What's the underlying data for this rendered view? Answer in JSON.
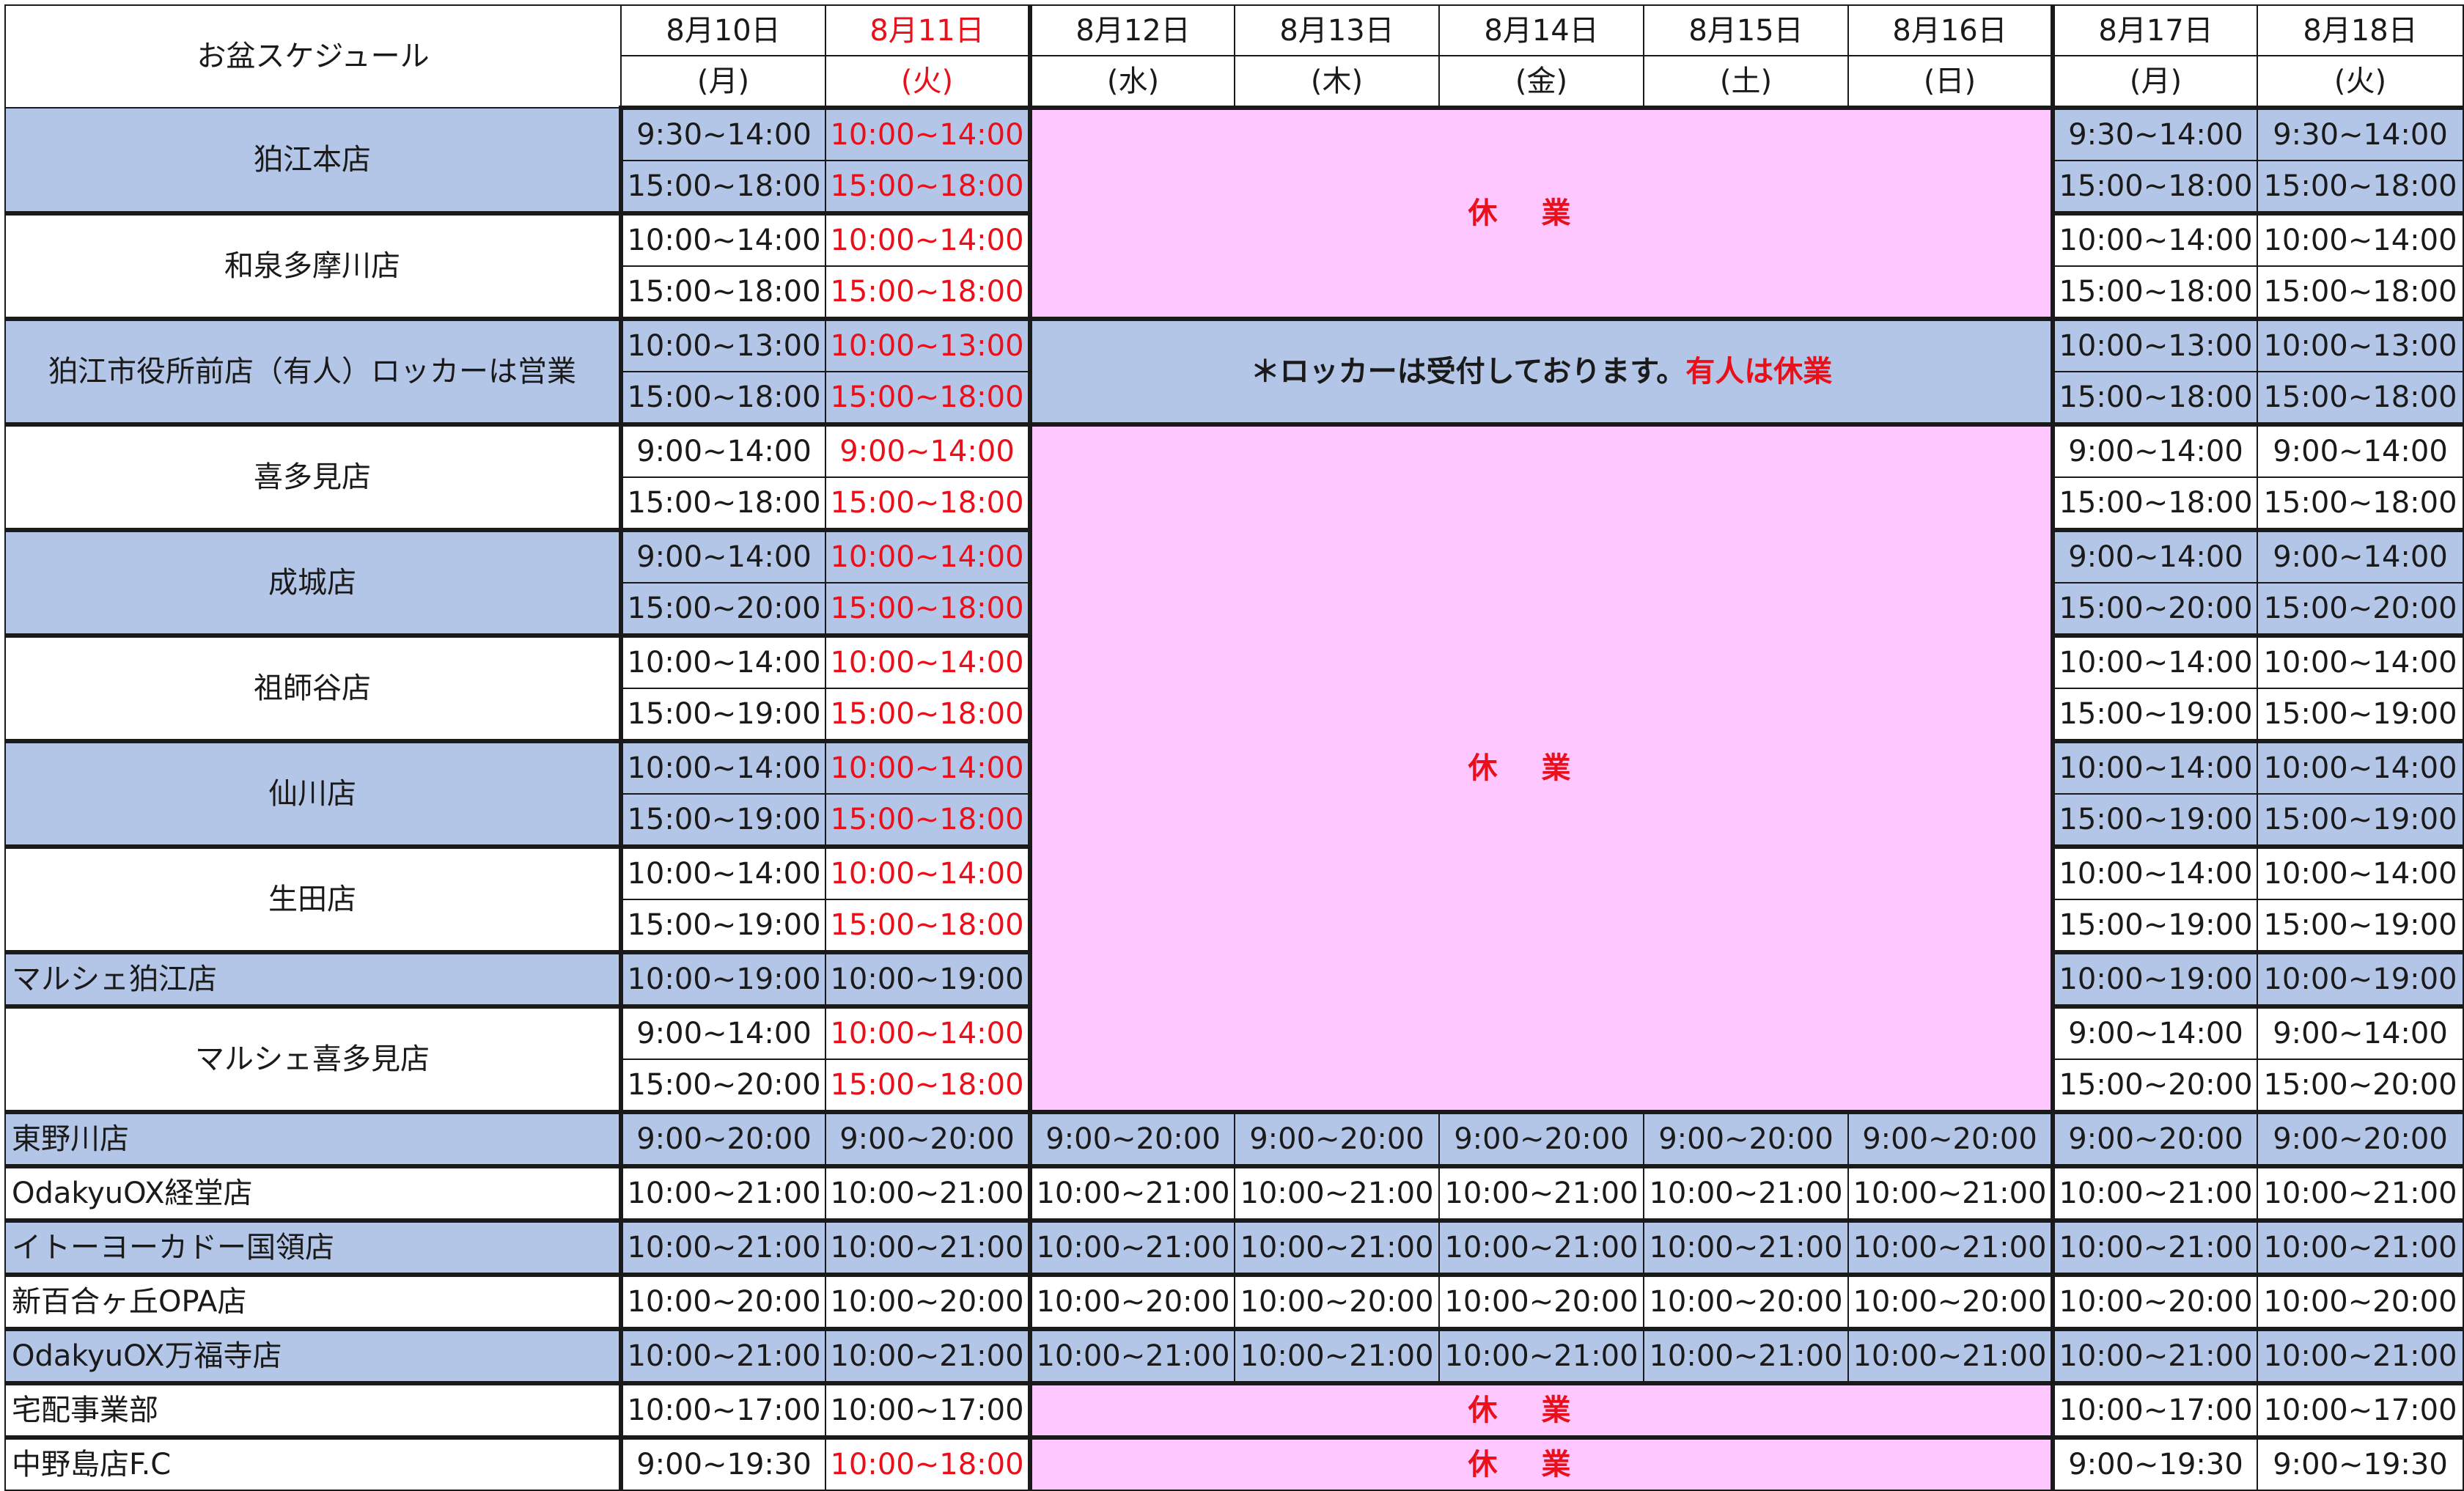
{
  "title": "お盆スケジュール",
  "dates": [
    {
      "date": "8月10日",
      "dow": "(月)",
      "red": false
    },
    {
      "date": "8月11日",
      "dow": "(火)",
      "red": true
    },
    {
      "date": "8月12日",
      "dow": "(水)",
      "red": false
    },
    {
      "date": "8月13日",
      "dow": "(木)",
      "red": false
    },
    {
      "date": "8月14日",
      "dow": "(金)",
      "red": false
    },
    {
      "date": "8月15日",
      "dow": "(土)",
      "red": false
    },
    {
      "date": "8月16日",
      "dow": "(日)",
      "red": false
    },
    {
      "date": "8月17日",
      "dow": "(月)",
      "red": false
    },
    {
      "date": "8月18日",
      "dow": "(火)",
      "red": false
    }
  ],
  "closed_label": "休業",
  "locker_note": {
    "black": "＊ロッカーは受付しております。",
    "red": "有人は休業"
  },
  "colors": {
    "blue": "#b4c6e7",
    "pink": "#ffc7ff",
    "red": "#e8101a"
  },
  "stores": [
    {
      "name": "狛江本店",
      "bg": "blue",
      "align": "center",
      "rows": [
        [
          "9:30~14:00",
          "10:00~14:00",
          "9:30~14:00",
          "9:30~14:00"
        ],
        [
          "15:00~18:00",
          "15:00~18:00",
          "15:00~18:00",
          "15:00~18:00"
        ]
      ],
      "red11": true,
      "mid": "closed-block"
    },
    {
      "name": "和泉多摩川店",
      "bg": "white",
      "align": "center",
      "rows": [
        [
          "10:00~14:00",
          "10:00~14:00",
          "10:00~14:00",
          "10:00~14:00"
        ],
        [
          "15:00~18:00",
          "15:00~18:00",
          "15:00~18:00",
          "15:00~18:00"
        ]
      ],
      "red11": true,
      "mid": "covered"
    },
    {
      "name": "狛江市役所前店（有人）ロッカーは営業",
      "bg": "blue",
      "align": "center",
      "rows": [
        [
          "10:00~13:00",
          "10:00~13:00",
          "10:00~13:00",
          "10:00~13:00"
        ],
        [
          "15:00~18:00",
          "15:00~18:00",
          "15:00~18:00",
          "15:00~18:00"
        ]
      ],
      "red11": true,
      "mid": "locker"
    },
    {
      "name": "喜多見店",
      "bg": "white",
      "align": "center",
      "rows": [
        [
          "9:00~14:00",
          "9:00~14:00",
          "9:00~14:00",
          "9:00~14:00"
        ],
        [
          "15:00~18:00",
          "15:00~18:00",
          "15:00~18:00",
          "15:00~18:00"
        ]
      ],
      "red11": true,
      "mid": "closed-big"
    },
    {
      "name": "成城店",
      "bg": "blue",
      "align": "center",
      "rows": [
        [
          "9:00~14:00",
          "10:00~14:00",
          "9:00~14:00",
          "9:00~14:00"
        ],
        [
          "15:00~20:00",
          "15:00~18:00",
          "15:00~20:00",
          "15:00~20:00"
        ]
      ],
      "red11": true,
      "mid": "covered"
    },
    {
      "name": "祖師谷店",
      "bg": "white",
      "align": "center",
      "rows": [
        [
          "10:00~14:00",
          "10:00~14:00",
          "10:00~14:00",
          "10:00~14:00"
        ],
        [
          "15:00~19:00",
          "15:00~18:00",
          "15:00~19:00",
          "15:00~19:00"
        ]
      ],
      "red11": true,
      "mid": "covered"
    },
    {
      "name": "仙川店",
      "bg": "blue",
      "align": "center",
      "rows": [
        [
          "10:00~14:00",
          "10:00~14:00",
          "10:00~14:00",
          "10:00~14:00"
        ],
        [
          "15:00~19:00",
          "15:00~18:00",
          "15:00~19:00",
          "15:00~19:00"
        ]
      ],
      "red11": true,
      "mid": "covered"
    },
    {
      "name": "生田店",
      "bg": "white",
      "align": "center",
      "rows": [
        [
          "10:00~14:00",
          "10:00~14:00",
          "10:00~14:00",
          "10:00~14:00"
        ],
        [
          "15:00~19:00",
          "15:00~18:00",
          "15:00~19:00",
          "15:00~19:00"
        ]
      ],
      "red11": true,
      "mid": "covered"
    },
    {
      "name": "マルシェ狛江店",
      "bg": "blue",
      "align": "left",
      "rows": [
        [
          "10:00~19:00",
          "10:00~19:00",
          "10:00~19:00",
          "10:00~19:00"
        ]
      ],
      "red11": false,
      "mid": "covered"
    },
    {
      "name": "マルシェ喜多見店",
      "bg": "white",
      "align": "center",
      "rows": [
        [
          "9:00~14:00",
          "10:00~14:00",
          "9:00~14:00",
          "9:00~14:00"
        ],
        [
          "15:00~20:00",
          "15:00~18:00",
          "15:00~20:00",
          "15:00~20:00"
        ]
      ],
      "red11": true,
      "mid": "covered"
    }
  ],
  "full_stores": [
    {
      "name": "東野川店",
      "bg": "blue",
      "hours": [
        "9:00~20:00",
        "9:00~20:00",
        "9:00~20:00",
        "9:00~20:00",
        "9:00~20:00",
        "9:00~20:00",
        "9:00~20:00",
        "9:00~20:00",
        "9:00~20:00"
      ]
    },
    {
      "name": "OdakyuOX経堂店",
      "bg": "white",
      "hours": [
        "10:00~21:00",
        "10:00~21:00",
        "10:00~21:00",
        "10:00~21:00",
        "10:00~21:00",
        "10:00~21:00",
        "10:00~21:00",
        "10:00~21:00",
        "10:00~21:00"
      ]
    },
    {
      "name": "イトーヨーカドー国領店",
      "bg": "blue",
      "hours": [
        "10:00~21:00",
        "10:00~21:00",
        "10:00~21:00",
        "10:00~21:00",
        "10:00~21:00",
        "10:00~21:00",
        "10:00~21:00",
        "10:00~21:00",
        "10:00~21:00"
      ]
    },
    {
      "name": "新百合ヶ丘OPA店",
      "bg": "white",
      "hours": [
        "10:00~20:00",
        "10:00~20:00",
        "10:00~20:00",
        "10:00~20:00",
        "10:00~20:00",
        "10:00~20:00",
        "10:00~20:00",
        "10:00~20:00",
        "10:00~20:00"
      ]
    },
    {
      "name": "OdakyuOX万福寺店",
      "bg": "blue",
      "hours": [
        "10:00~21:00",
        "10:00~21:00",
        "10:00~21:00",
        "10:00~21:00",
        "10:00~21:00",
        "10:00~21:00",
        "10:00~21:00",
        "10:00~21:00",
        "10:00~21:00"
      ]
    }
  ],
  "bottom_stores": [
    {
      "name": "宅配事業部",
      "hours": [
        "10:00~17:00",
        "10:00~17:00",
        "10:00~17:00",
        "10:00~17:00"
      ],
      "red11": false
    },
    {
      "name": "中野島店F.C",
      "hours": [
        "9:00~19:30",
        "10:00~18:00",
        "9:00~19:30",
        "9:00~19:30"
      ],
      "red11": true
    }
  ]
}
